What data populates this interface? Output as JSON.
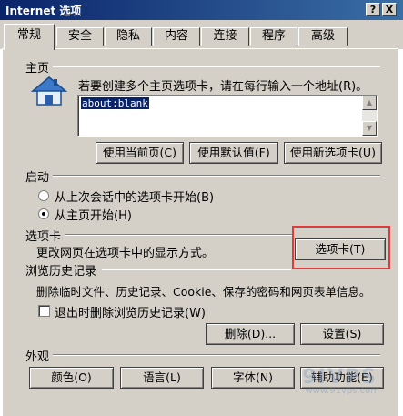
{
  "window": {
    "title": "Internet 选项",
    "help_button": "?",
    "close_button": "X"
  },
  "tabs": [
    {
      "label": "常规",
      "active": true
    },
    {
      "label": "安全"
    },
    {
      "label": "隐私"
    },
    {
      "label": "内容"
    },
    {
      "label": "连接"
    },
    {
      "label": "程序"
    },
    {
      "label": "高级"
    }
  ],
  "home_page": {
    "section_title": "主页",
    "instruction": "若要创建多个主页选项卡，请在每行输入一个地址(R)。",
    "address_value": "about:blank",
    "buttons": {
      "use_current": "使用当前页(C)",
      "use_default": "使用默认值(F)",
      "use_new_tab": "使用新选项卡(U)"
    }
  },
  "startup": {
    "section_title": "启动",
    "option_last_session": "从上次会话中的选项卡开始(B)",
    "option_home_page": "从主页开始(H)",
    "selected": "home_page"
  },
  "tabs_section": {
    "section_title": "选项卡",
    "description": "更改网页在选项卡中的显示方式。",
    "button": "选项卡(T)"
  },
  "browsing_history": {
    "section_title": "浏览历史记录",
    "description": "删除临时文件、历史记录、Cookie、保存的密码和网页表单信息。",
    "checkbox_label": "退出时删除浏览历史记录(W)",
    "checkbox_checked": false,
    "delete_button": "删除(D)...",
    "settings_button": "设置(S)"
  },
  "appearance": {
    "section_title": "外观",
    "colors_button": "颜色(O)",
    "languages_button": "语言(L)",
    "fonts_button": "字体(N)",
    "accessibility_button": "辅助功能(E)"
  },
  "watermark": {
    "main": "9IVPS",
    "sub": "www.91vps.com"
  }
}
